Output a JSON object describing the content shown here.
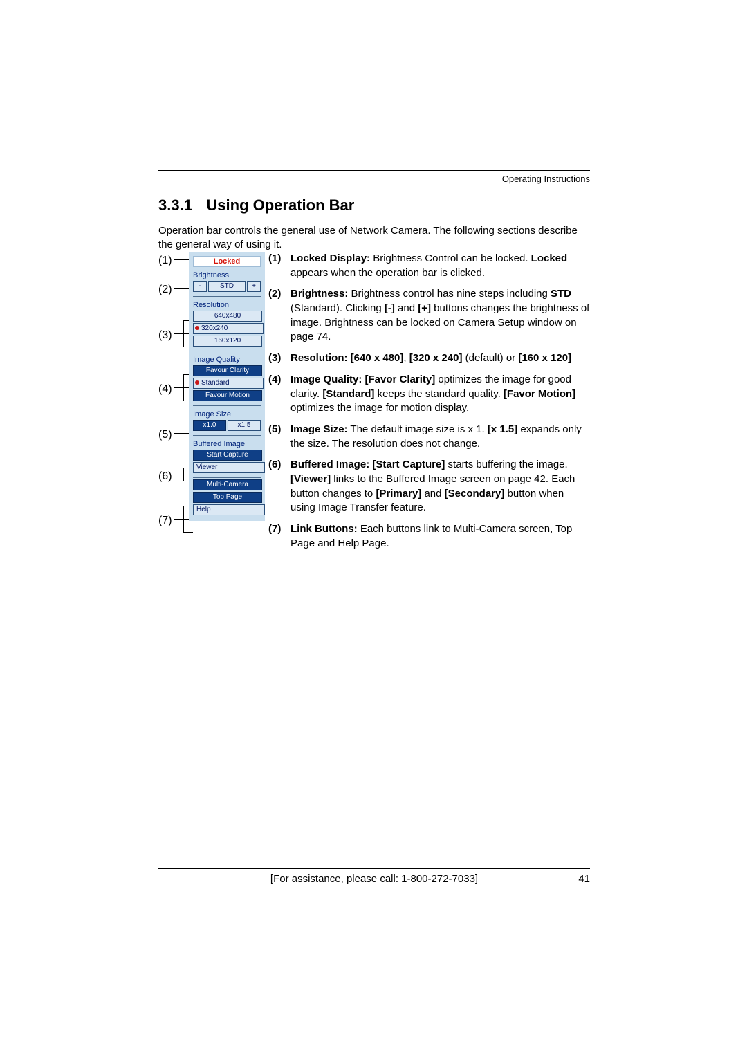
{
  "running_header": "Operating Instructions",
  "section": {
    "number": "3.3.1",
    "title": "Using Operation Bar"
  },
  "intro": "Operation bar controls the general use of Network Camera. The following sections describe the general way of using it.",
  "callouts": [
    "(1)",
    "(2)",
    "(3)",
    "(4)",
    "(5)",
    "(6)",
    "(7)"
  ],
  "opbar": {
    "locked": "Locked",
    "brightness_label": "Brightness",
    "brightness_minus": "-",
    "brightness_std": "STD",
    "brightness_plus": "+",
    "resolution_label": "Resolution",
    "res_640": "640x480",
    "res_320": "320x240",
    "res_160": "160x120",
    "image_quality_label": "Image Quality",
    "iq_clarity": "Favour Clarity",
    "iq_standard": "Standard",
    "iq_motion": "Favour Motion",
    "image_size_label": "Image Size",
    "size_x1": "x1.0",
    "size_x15": "x1.5",
    "buffered_label": "Buffered Image",
    "start_capture": "Start Capture",
    "viewer": "Viewer",
    "multi_camera": "Multi-Camera",
    "top_page": "Top Page",
    "help": "Help"
  },
  "desc": {
    "n1": "(1)",
    "n2": "(2)",
    "n3": "(3)",
    "n4": "(4)",
    "n5": "(5)",
    "n6": "(6)",
    "n7": "(7)",
    "d1_a": "Locked Display:",
    "d1_b": " Brightness Control can be locked. ",
    "d1_c": "Locked",
    "d1_d": " appears when the operation bar is clicked.",
    "d2_a": "Brightness:",
    "d2_b": " Brightness control has nine steps including ",
    "d2_c": "STD",
    "d2_d": " (Standard). Clicking ",
    "d2_e": "[-]",
    "d2_f": " and ",
    "d2_g": "[+]",
    "d2_h": " buttons changes the brightness of image. Brightness can be locked on Camera Setup window on page 74.",
    "d3_a": "Resolution: [640 x 480]",
    "d3_b": ", ",
    "d3_c": "[320 x 240]",
    "d3_d": " (default) or ",
    "d3_e": "[160 x 120]",
    "d4_a": "Image Quality: [Favor Clarity]",
    "d4_b": " optimizes the image for good clarity. ",
    "d4_c": "[Standard]",
    "d4_d": " keeps the standard quality. ",
    "d4_e": "[Favor Motion]",
    "d4_f": " optimizes the image for motion display.",
    "d5_a": "Image Size:",
    "d5_b": " The default image size is x 1. ",
    "d5_c": "[x 1.5]",
    "d5_d": " expands only the size. The resolution does not change.",
    "d6_a": "Buffered Image: [Start Capture]",
    "d6_b": " starts buffering the image. ",
    "d6_c": "[Viewer]",
    "d6_d": " links to the Buffered Image screen on page 42. Each button changes to ",
    "d6_e": "[Primary]",
    "d6_f": " and ",
    "d6_g": "[Secondary]",
    "d6_h": " button when using Image Transfer feature.",
    "d7_a": "Link Buttons:",
    "d7_b": " Each buttons link to Multi-Camera screen, Top Page and Help Page."
  },
  "footer": {
    "assist": "[For assistance, please call: 1-800-272-7033]",
    "page": "41"
  }
}
